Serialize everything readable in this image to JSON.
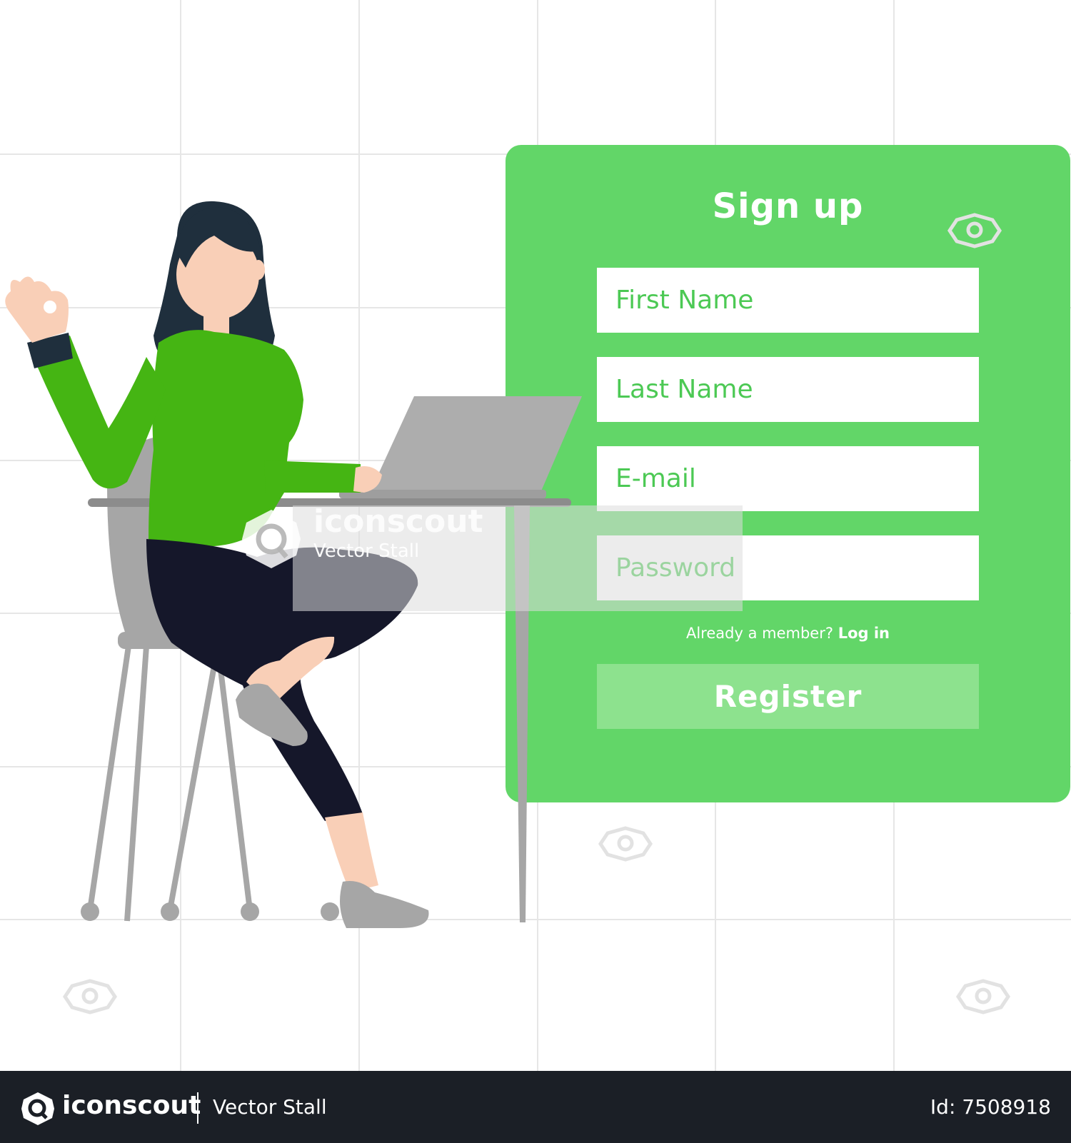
{
  "form": {
    "title": "Sign up",
    "fields": [
      {
        "placeholder": "First Name"
      },
      {
        "placeholder": "Last Name"
      },
      {
        "placeholder": "E-mail"
      },
      {
        "placeholder": "Password"
      }
    ],
    "member_prompt": "Already a member?",
    "login_label": "Log in",
    "register_label": "Register"
  },
  "watermark": {
    "brand": "iconscout",
    "author": "Vector Stall"
  },
  "footer": {
    "brand": "iconscout",
    "author": "Vector Stall",
    "asset_id": "Id: 7508918"
  },
  "colors": {
    "card": "#62d668",
    "register_button": "#8de28e",
    "field_text": "#4cc954",
    "sweater": "#45b513",
    "hair": "#1f2f3d",
    "skin": "#f9cfb7",
    "pants": "#15172a",
    "furniture": "#a6a6a6",
    "footer": "#1b1f26"
  },
  "icons": [
    "iconscout-logo-icon",
    "iconscout-watermark-icon"
  ]
}
